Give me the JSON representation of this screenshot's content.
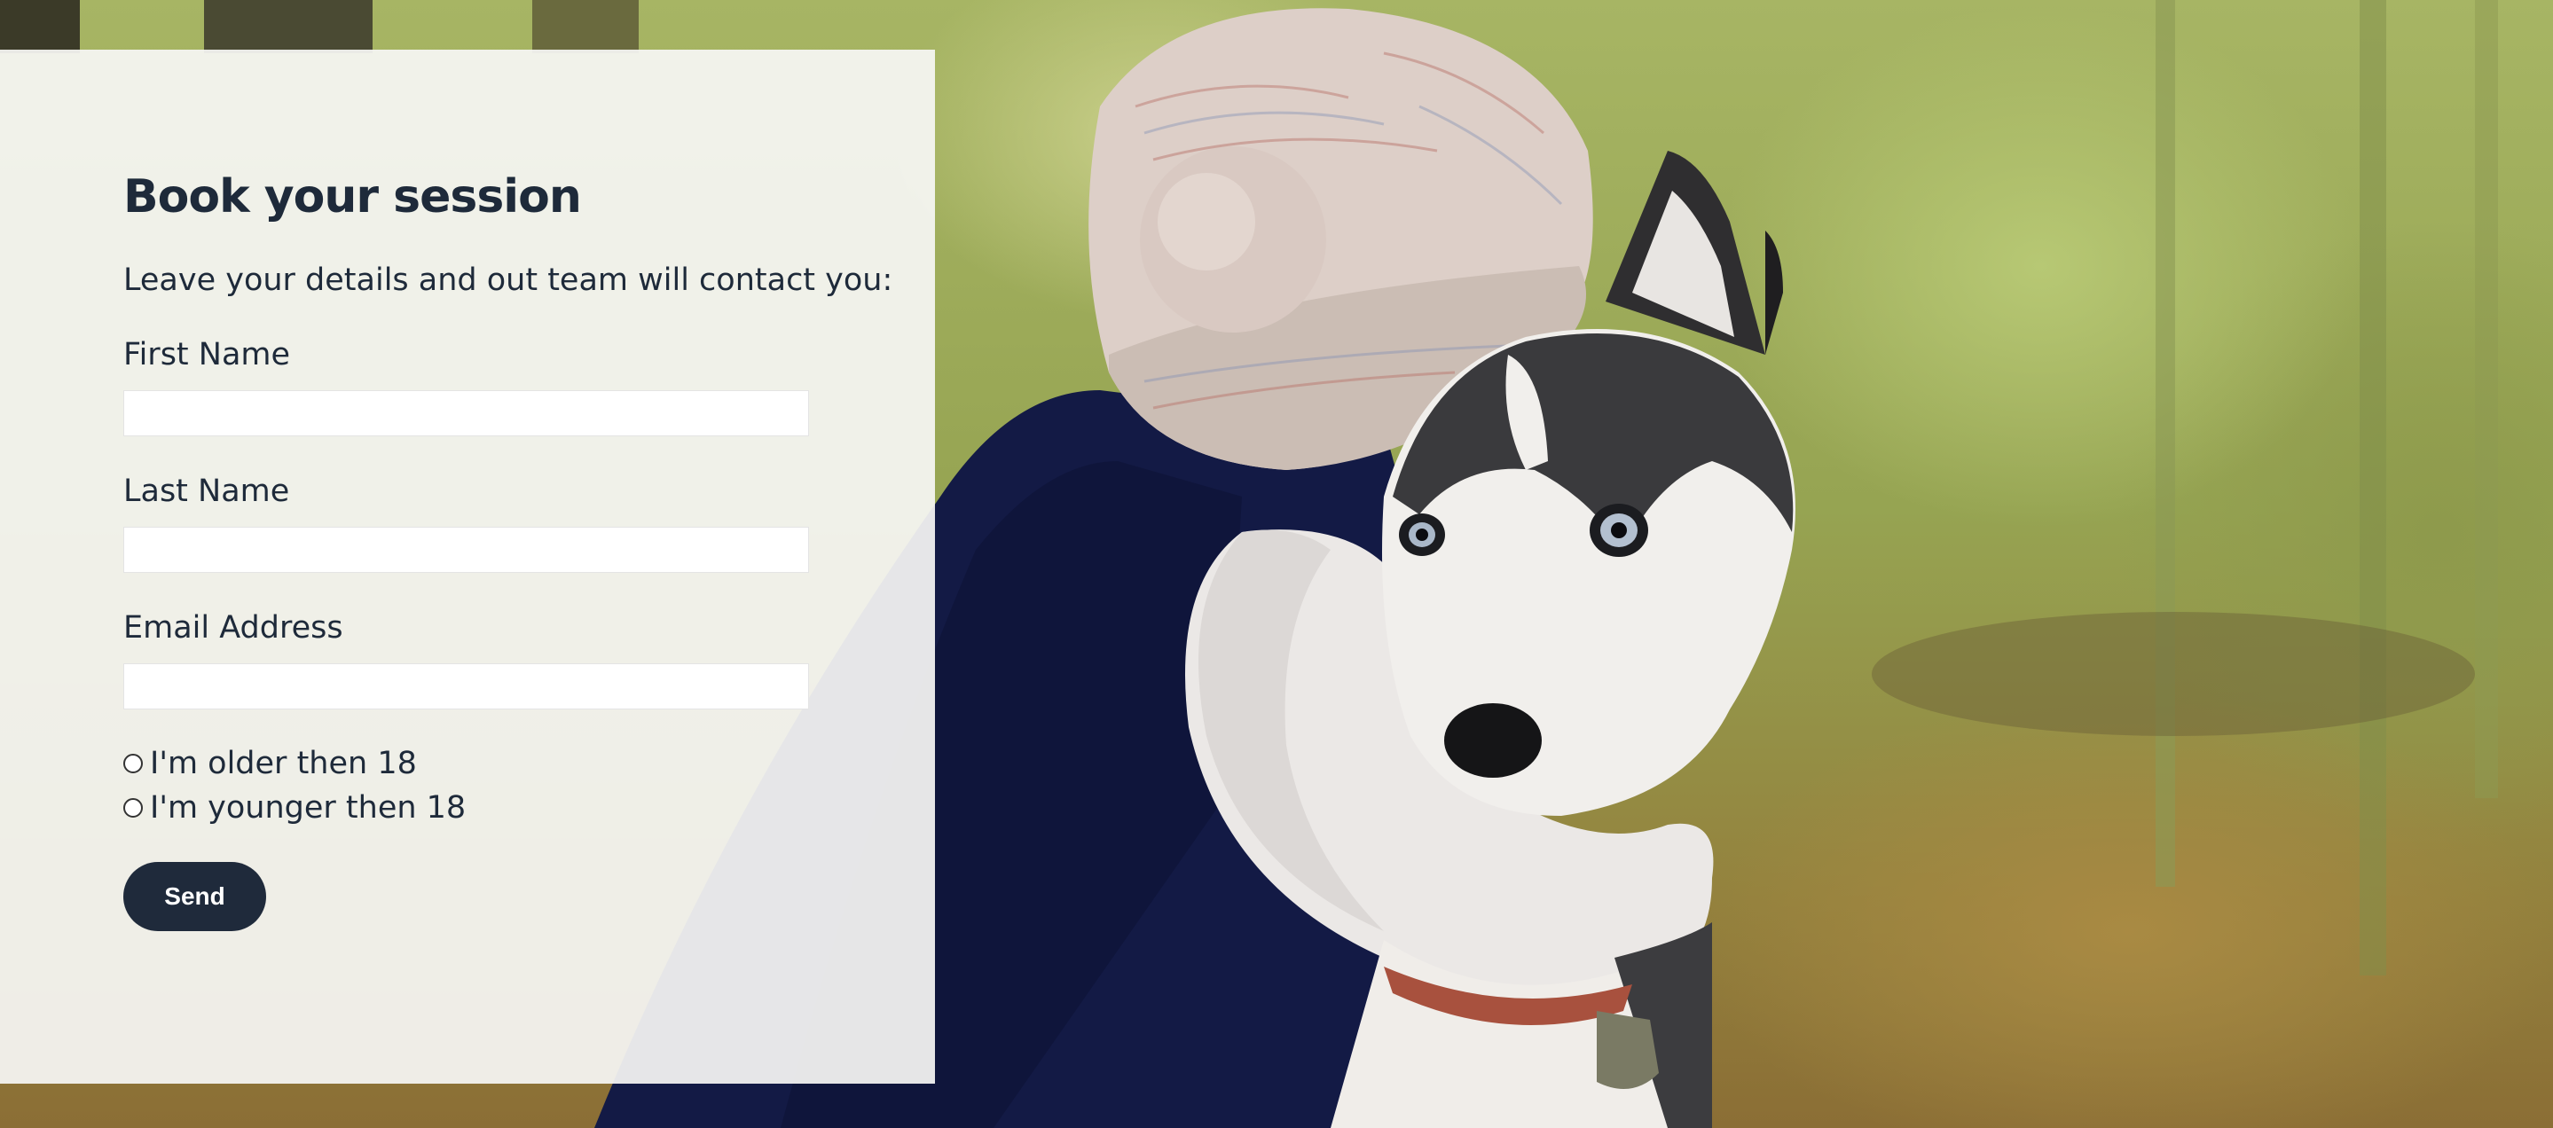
{
  "form": {
    "title": "Book your session",
    "subtitle": "Leave your details and out team will contact you:",
    "fields": [
      {
        "label": "First Name",
        "value": "",
        "placeholder": ""
      },
      {
        "label": "Last Name",
        "value": "",
        "placeholder": ""
      },
      {
        "label": "Email Address",
        "value": "",
        "placeholder": ""
      }
    ],
    "age_options": [
      {
        "label": "I'm older then 18",
        "selected": false
      },
      {
        "label": "I'm younger then 18",
        "selected": false
      }
    ],
    "submit_label": "Send"
  },
  "background": {
    "subject": "child in knitted hat hugging a husky dog in an autumn forest"
  },
  "colors": {
    "accent": "#1f2a3b",
    "panel": "#f6f6f4",
    "text": "#1e2a3a"
  }
}
